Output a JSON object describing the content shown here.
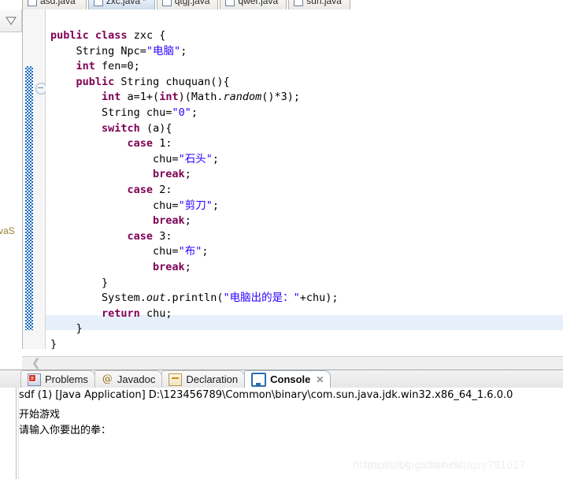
{
  "editor_tabs": [
    {
      "label": "asd.java",
      "dirty": "",
      "active": false
    },
    {
      "label": "zxc.java",
      "dirty": "*",
      "active": true
    },
    {
      "label": "qtgj.java",
      "dirty": "",
      "active": false
    },
    {
      "label": "qwer.java",
      "dirty": "",
      "active": false
    },
    {
      "label": "sun.java",
      "dirty": "",
      "active": false
    }
  ],
  "left_rail": {
    "restore_icon": "triangle-down-icon",
    "vertical_tab_label": "vaS"
  },
  "gutter": {
    "fold_marker": "collapse-fold-icon",
    "change_bar_color": "#1569c0"
  },
  "code": {
    "language": "java",
    "current_line_highlight_color": "#e7effb",
    "keyword_color": "#7f0055",
    "string_color": "#2a00ff",
    "lines": [
      "public class zxc {",
      "    String Npc=\"电脑\";",
      "    int fen=0;",
      "    public String chuquan(){",
      "        int a=1+(int)(Math.random()*3);",
      "        String chu=\"0\";",
      "        switch (a){",
      "            case 1:",
      "                chu=\"石头\";",
      "                break;",
      "            case 2:",
      "                chu=\"剪刀\";",
      "                break;",
      "            case 3:",
      "                chu=\"布\";",
      "                break;",
      "        }",
      "        System.out.println(\"电脑出的是：\"+chu);",
      "        return chu;",
      "    }",
      "}"
    ]
  },
  "scrollbar": {
    "left_arrow": "chevron-left-icon"
  },
  "bottom_view": {
    "tabs": [
      {
        "label": "Problems",
        "icon": "problems-icon",
        "active": false,
        "close": ""
      },
      {
        "label": "Javadoc",
        "icon": "javadoc-at-icon",
        "active": false,
        "close": ""
      },
      {
        "label": "Declaration",
        "icon": "declaration-icon",
        "active": false,
        "close": ""
      },
      {
        "label": "Console",
        "icon": "console-monitor-icon",
        "active": true,
        "close": "✕"
      }
    ],
    "console": {
      "process_line": "sdf (1) [Java Application] D:\\123456789\\Common\\binary\\com.sun.java.jdk.win32.x86_64_1.6.0.0",
      "output_line_1": "开始游戏",
      "output_line_2": "请输入你要出的拳："
    }
  },
  "watermark": {
    "text_1": "https://blog.csdn.net/...",
    "text_2": "https://blog.csdn.net/qzy781027"
  }
}
